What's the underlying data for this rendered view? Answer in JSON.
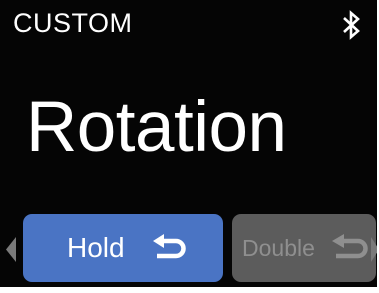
{
  "header": {
    "mode_label": "CUSTOM",
    "status_icon": "bluetooth-icon"
  },
  "main": {
    "title": "Rotation"
  },
  "actions": [
    {
      "label": "Hold",
      "icon": "return-arrow-icon",
      "selected": true,
      "color": "#4a74c4"
    },
    {
      "label": "Double",
      "icon": "return-arrow-icon",
      "selected": false,
      "color": "#5c5c5c"
    }
  ],
  "navigation": {
    "left_icon": "arrow-left-icon",
    "right_icon": "arrow-right-icon"
  },
  "colors": {
    "background": "#050505",
    "text": "#ffffff",
    "selected_button": "#4a74c4",
    "unselected_button": "#5c5c5c",
    "unselected_text": "#8f8f8f"
  }
}
